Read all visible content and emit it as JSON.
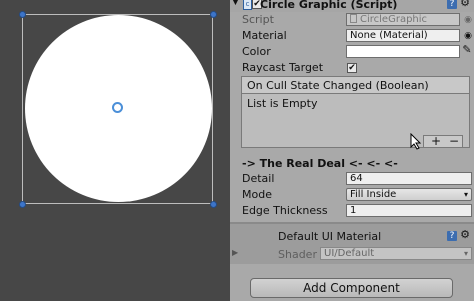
{
  "component": {
    "title": "Circle Graphic (Script)",
    "enabled": true,
    "icons": {
      "script": "script-icon",
      "help": "help-book-icon",
      "settings": "gear-icon",
      "picker": "object-picker-icon",
      "eyedropper": "eyedropper-icon"
    }
  },
  "fields": {
    "script_label": "Script",
    "script_value": "CircleGraphic",
    "material_label": "Material",
    "material_value": "None (Material)",
    "color_label": "Color",
    "color_value": "#ffffff",
    "raycast_label": "Raycast Target",
    "raycast_checked": true
  },
  "event": {
    "header": "On Cull State Changed (Boolean)",
    "empty_text": "List is Empty",
    "add_label": "+",
    "remove_label": "−"
  },
  "section": {
    "title": "-> The Real Deal <- <- <-",
    "detail_label": "Detail",
    "detail_value": "64",
    "mode_label": "Mode",
    "mode_value": "Fill Inside",
    "edge_label": "Edge Thickness",
    "edge_value": "1"
  },
  "material_block": {
    "name": "Default UI Material",
    "shader_label": "Shader",
    "shader_value": "UI/Default"
  },
  "add_component": "Add Component"
}
